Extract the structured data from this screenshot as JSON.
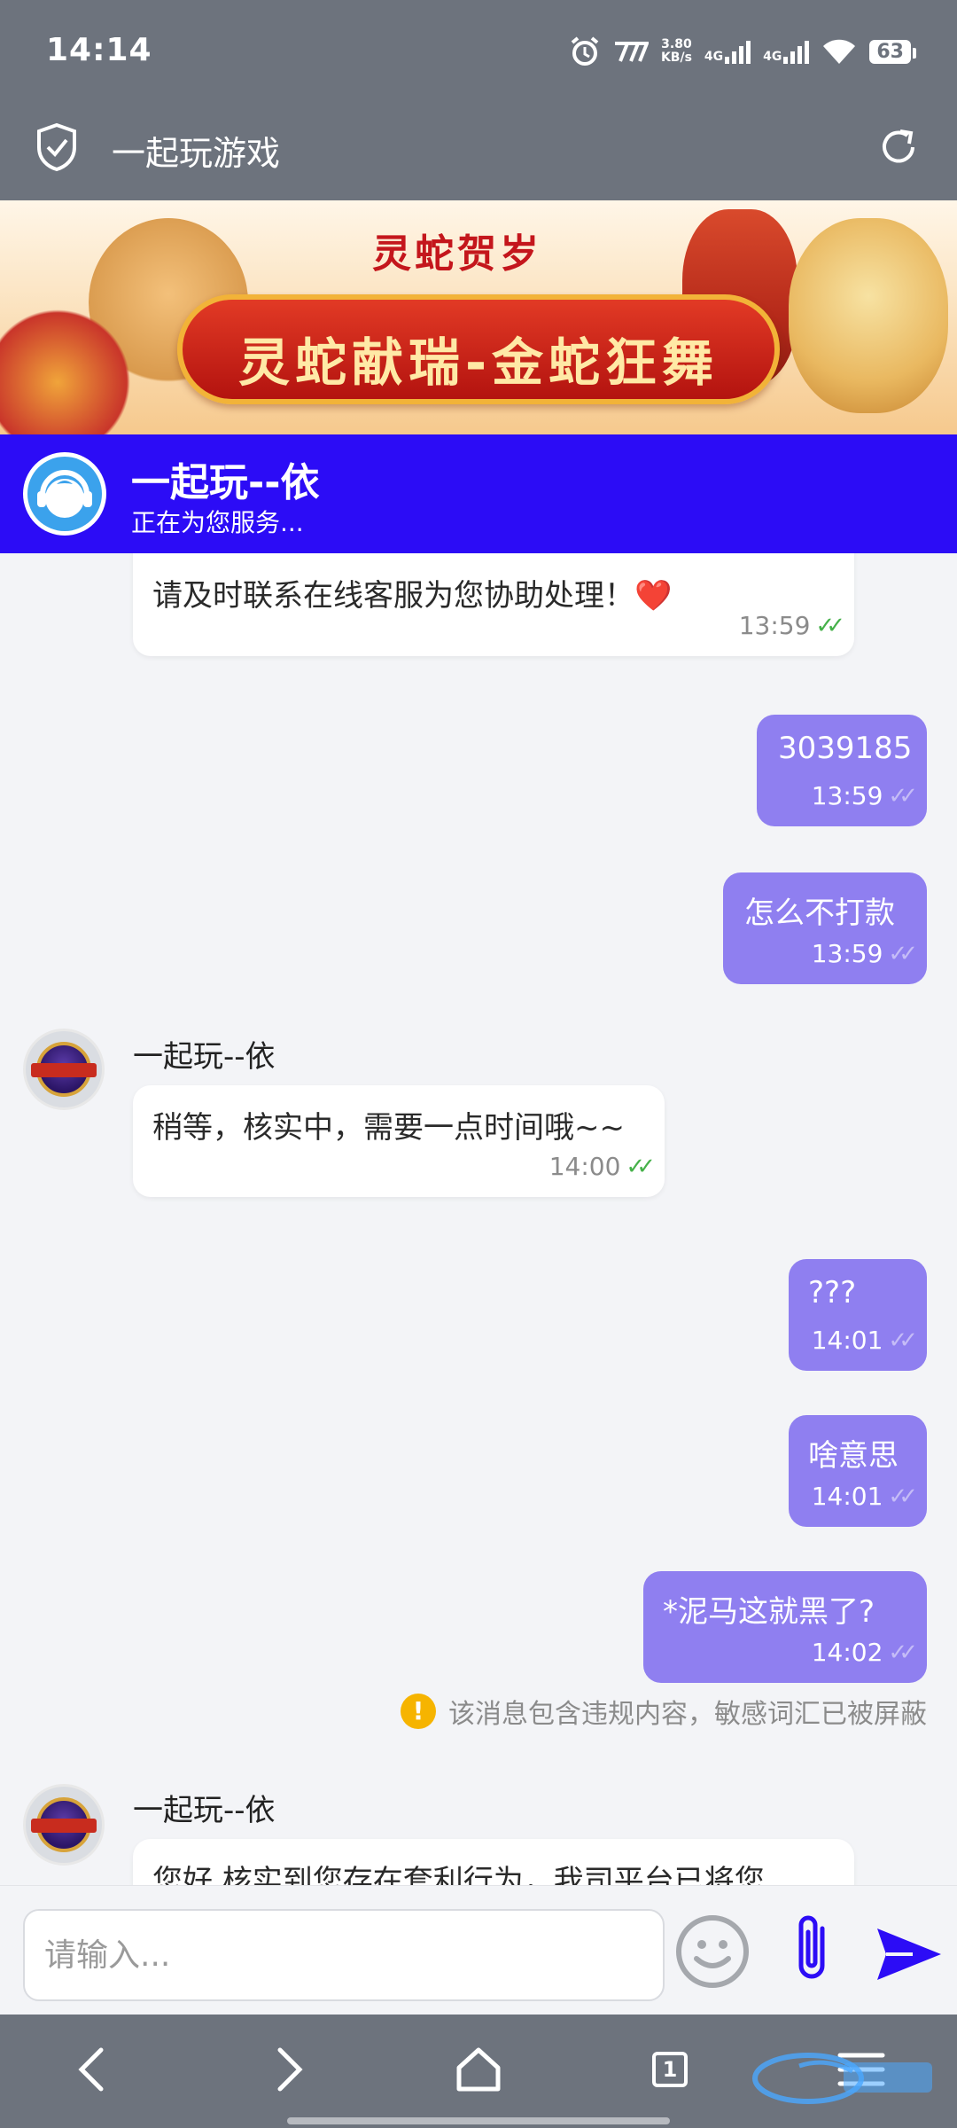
{
  "status_bar": {
    "time": "14:14",
    "net_speed_value": "3.80",
    "net_speed_unit": "KB/s",
    "signal1_label": "4G",
    "signal2_label": "4G",
    "battery": "63"
  },
  "browser": {
    "page_title": "一起玩游戏"
  },
  "banner": {
    "tagline": "灵蛇贺岁",
    "headline": "灵蛇献瑞-金蛇狂舞"
  },
  "chat_header": {
    "agent_name": "一起玩--依",
    "status": "正在为您服务..."
  },
  "messages": [
    {
      "direction": "in",
      "text": "请及时联系在线客服为您协助处理！❤️",
      "time": "13:59"
    },
    {
      "direction": "out",
      "text": "3039185",
      "time": "13:59"
    },
    {
      "direction": "out",
      "text": "怎么不打款",
      "time": "13:59"
    },
    {
      "direction": "in",
      "sender": "一起玩--依",
      "text": "稍等，核实中，需要一点时间哦~~",
      "time": "14:00"
    },
    {
      "direction": "out",
      "text": "???",
      "time": "14:01"
    },
    {
      "direction": "out",
      "text": "啥意思",
      "time": "14:01"
    },
    {
      "direction": "out",
      "text": "*泥马这就黑了?",
      "time": "14:02"
    },
    {
      "direction": "in",
      "sender": "一起玩--依",
      "text": "您好,核实到您存在套利行为，我司平台已将您"
    }
  ],
  "notice": {
    "text": "该消息包含违规内容，敏感词汇已被屏蔽"
  },
  "input": {
    "placeholder": "请输入..."
  },
  "nav": {
    "tab_count": "1"
  },
  "colors": {
    "chat_header_bg": "#2c0cf6",
    "outgoing_bubble": "#8f7ff0",
    "system_bar": "#6d737d",
    "warning": "#f6b400"
  }
}
